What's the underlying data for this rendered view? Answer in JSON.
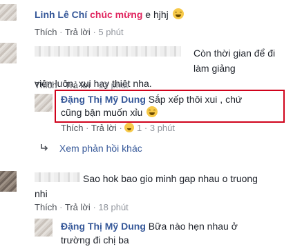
{
  "comments": [
    {
      "author": "Linh Lê Chí",
      "tag": "chúc mừng",
      "text": "e hjhj",
      "actions": {
        "like": "Thích",
        "reply": "Trả lời",
        "time": "5 phút"
      }
    },
    {
      "text_line1": "Còn thời gian để đi làm giảng",
      "text_line2": "viên luôn, xui hay thiệt nha.",
      "actions": {
        "like": "Thích",
        "reply": "Trả lời",
        "time": "12 phút"
      },
      "reply": {
        "author": "Đặng Thị Mỹ Dung",
        "text_line1": "Sắp xếp thôi xui , chứ",
        "text_line2": "cũng bận muốn xỉu",
        "actions": {
          "like": "Thích",
          "reply": "Trả lời",
          "reaction_count": "1",
          "time": "3 phút"
        },
        "highlight_color": "#d0021b"
      },
      "more_replies": "Xem phản hồi khác"
    },
    {
      "text_line1": "Sao hok bao gio minh gap nhau o truong",
      "text_line2": "nhi",
      "actions": {
        "like": "Thích",
        "reply": "Trả lời",
        "time": "18 phút"
      },
      "reply": {
        "author": "Đặng Thị Mỹ Dung",
        "text_line1": "Bữa nào hẹn nhau ở",
        "text_line2": "trường đi chị ba"
      }
    }
  ],
  "separator": "·",
  "icons": {
    "reply_arrow": "reply-arrow-icon",
    "emoji": "laughing-face-icon"
  },
  "colors": {
    "link": "#365899",
    "tag": "#e0245e",
    "highlight": "#d0021b"
  }
}
